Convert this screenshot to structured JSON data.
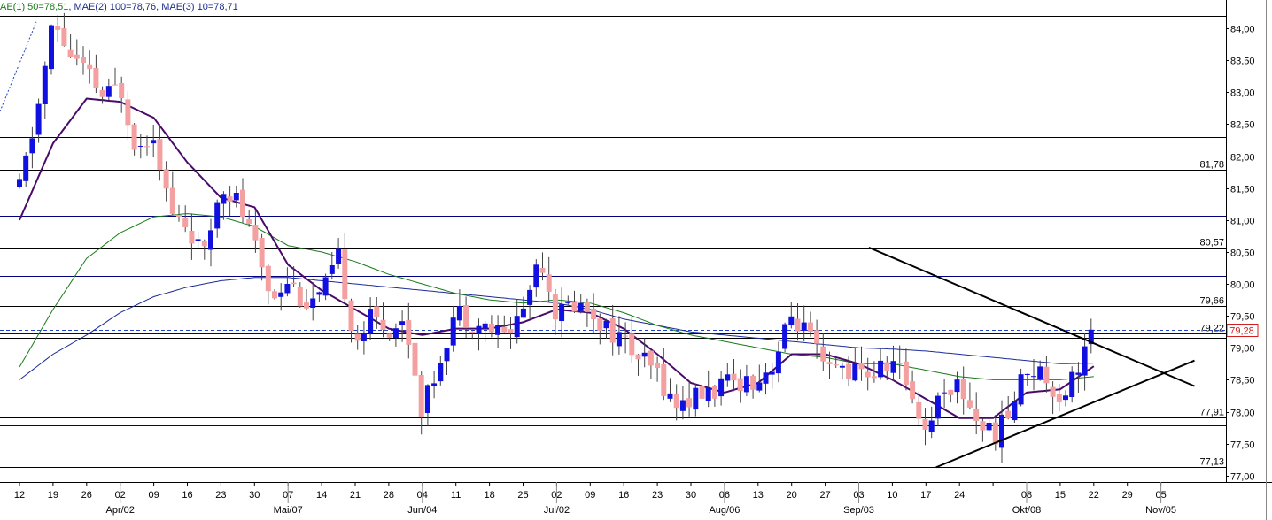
{
  "chart_data": {
    "type": "candlestick",
    "indicator_legend": [
      {
        "text": "AE(1) 50=78,51",
        "color": "#1a7a1a"
      },
      {
        "text": "MAE(2) 100=78,76",
        "color": "#1a2a8a"
      },
      {
        "text": "MAE(3) 10=78,71",
        "color": "#1a2a8a"
      }
    ],
    "y_axis": {
      "min": 76.9,
      "max": 84.25,
      "ticks": [
        "84,00",
        "83,50",
        "83,00",
        "82,50",
        "82,00",
        "81,50",
        "81,00",
        "80,50",
        "80,00",
        "79,50",
        "79,00",
        "78,50",
        "78,00",
        "77,50",
        "77,00"
      ],
      "tick_values": [
        84.0,
        83.5,
        83.0,
        82.5,
        82.0,
        81.5,
        81.0,
        80.5,
        80.0,
        79.5,
        79.0,
        78.5,
        78.0,
        77.5,
        77.0
      ]
    },
    "x_axis": {
      "day_labels": [
        "12",
        "19",
        "26",
        "02",
        "09",
        "16",
        "23",
        "30",
        "07",
        "14",
        "21",
        "28",
        "04",
        "11",
        "18",
        "25",
        "02",
        "09",
        "16",
        "23",
        "30",
        "06",
        "13",
        "20",
        "27",
        "03",
        "10",
        "17",
        "24",
        "",
        "08",
        "15",
        "22",
        "29",
        "05"
      ],
      "month_labels": [
        {
          "label": "Apr/02",
          "index": 3
        },
        {
          "label": "Mai/07",
          "index": 8
        },
        {
          "label": "Jun/04",
          "index": 12
        },
        {
          "label": "Jul/02",
          "index": 16
        },
        {
          "label": "Aug/06",
          "index": 21
        },
        {
          "label": "Sep/03",
          "index": 25
        },
        {
          "label": "Okt/08",
          "index": 30
        },
        {
          "label": "Nov/05",
          "index": 34
        }
      ]
    },
    "horizontal_levels": [
      {
        "value": 84.2,
        "label": "",
        "color": "#000000"
      },
      {
        "value": 82.3,
        "label": "",
        "color": "#000000"
      },
      {
        "value": 81.78,
        "label": "81,78",
        "color": "#000000"
      },
      {
        "value": 81.06,
        "label": "",
        "color": "#000080"
      },
      {
        "value": 80.57,
        "label": "80,57",
        "color": "#000000"
      },
      {
        "value": 80.12,
        "label": "",
        "color": "#000080"
      },
      {
        "value": 79.66,
        "label": "79,66",
        "color": "#000000"
      },
      {
        "value": 79.22,
        "label": "79,22",
        "color": "#000080"
      },
      {
        "value": 79.15,
        "label": "",
        "color": "#000000"
      },
      {
        "value": 77.91,
        "label": "77,91",
        "color": "#000000"
      },
      {
        "value": 77.78,
        "label": "",
        "color": "#000080"
      },
      {
        "value": 77.13,
        "label": "77,13",
        "color": "#000000"
      }
    ],
    "current_price": {
      "value": 79.28,
      "label": "79,28",
      "color": "#d02020"
    },
    "trendlines": [
      {
        "from": [
          25.3,
          80.57
        ],
        "to": [
          35.0,
          78.4
        ]
      },
      {
        "from": [
          27.3,
          77.13
        ],
        "to": [
          35.0,
          78.8
        ]
      }
    ],
    "ohlc_path": [
      [
        0,
        81.5
      ],
      [
        0.5,
        82.6
      ],
      [
        1,
        84.1
      ],
      [
        1.5,
        83.6
      ],
      [
        2,
        83.3
      ],
      [
        2.5,
        82.9
      ],
      [
        3,
        83.1
      ],
      [
        3.5,
        82.1
      ],
      [
        4,
        82.4
      ],
      [
        4.5,
        81.1
      ],
      [
        5,
        80.9
      ],
      [
        5.5,
        80.4
      ],
      [
        6,
        81.6
      ],
      [
        6.5,
        81.3
      ],
      [
        7,
        80.6
      ],
      [
        7.5,
        79.8
      ],
      [
        8,
        80.1
      ],
      [
        8.5,
        79.7
      ],
      [
        9,
        79.8
      ],
      [
        9.5,
        80.4
      ],
      [
        10,
        79.1
      ],
      [
        10.5,
        79.5
      ],
      [
        11,
        79.3
      ],
      [
        11.5,
        79.4
      ],
      [
        12,
        78.0
      ],
      [
        12.5,
        78.8
      ],
      [
        13,
        79.6
      ],
      [
        13.5,
        79.4
      ],
      [
        14,
        79.3
      ],
      [
        14.5,
        79.2
      ],
      [
        15,
        79.6
      ],
      [
        15.5,
        80.5
      ],
      [
        16,
        79.5
      ],
      [
        16.5,
        79.7
      ],
      [
        17,
        79.6
      ],
      [
        17.5,
        79.3
      ],
      [
        18,
        79.1
      ],
      [
        18.5,
        78.8
      ],
      [
        19,
        78.6
      ],
      [
        19.5,
        78.1
      ],
      [
        20,
        78.2
      ],
      [
        20.5,
        78.3
      ],
      [
        21,
        78.4
      ],
      [
        21.5,
        78.5
      ],
      [
        22,
        78.5
      ],
      [
        22.5,
        78.8
      ],
      [
        23,
        79.5
      ],
      [
        23.5,
        79.2
      ],
      [
        24,
        78.6
      ],
      [
        24.5,
        78.7
      ],
      [
        25,
        78.6
      ],
      [
        25.5,
        78.6
      ],
      [
        26,
        78.8
      ],
      [
        26.5,
        78.4
      ],
      [
        27,
        77.7
      ],
      [
        27.5,
        78.4
      ],
      [
        28,
        78.4
      ],
      [
        28.5,
        77.9
      ],
      [
        29,
        77.6
      ],
      [
        29.5,
        78.0
      ],
      [
        30,
        78.7
      ],
      [
        30.5,
        78.6
      ],
      [
        31,
        78.2
      ],
      [
        31.5,
        78.7
      ],
      [
        32,
        79.3
      ]
    ],
    "ma_green_path": [
      [
        0,
        78.7
      ],
      [
        1,
        79.6
      ],
      [
        2,
        80.4
      ],
      [
        3,
        80.8
      ],
      [
        4,
        81.05
      ],
      [
        5,
        81.1
      ],
      [
        6,
        81.05
      ],
      [
        7,
        80.9
      ],
      [
        8,
        80.6
      ],
      [
        9,
        80.5
      ],
      [
        10,
        80.35
      ],
      [
        11,
        80.15
      ],
      [
        12,
        80.0
      ],
      [
        13,
        79.85
      ],
      [
        14,
        79.75
      ],
      [
        15,
        79.7
      ],
      [
        16,
        79.75
      ],
      [
        17,
        79.7
      ],
      [
        18,
        79.55
      ],
      [
        19,
        79.35
      ],
      [
        20,
        79.2
      ],
      [
        21,
        79.1
      ],
      [
        22,
        79.0
      ],
      [
        23,
        78.9
      ],
      [
        24,
        78.85
      ],
      [
        25,
        78.75
      ],
      [
        26,
        78.75
      ],
      [
        27,
        78.65
      ],
      [
        28,
        78.55
      ],
      [
        29,
        78.5
      ],
      [
        30,
        78.5
      ],
      [
        31,
        78.5
      ],
      [
        32,
        78.55
      ]
    ],
    "ma_blue_path": [
      [
        0,
        78.5
      ],
      [
        1,
        78.9
      ],
      [
        2,
        79.2
      ],
      [
        3,
        79.55
      ],
      [
        4,
        79.8
      ],
      [
        5,
        79.95
      ],
      [
        6,
        80.05
      ],
      [
        7,
        80.1
      ],
      [
        8,
        80.1
      ],
      [
        9,
        80.05
      ],
      [
        10,
        80.0
      ],
      [
        11,
        79.95
      ],
      [
        12,
        79.9
      ],
      [
        13,
        79.85
      ],
      [
        14,
        79.8
      ],
      [
        15,
        79.75
      ],
      [
        16,
        79.7
      ],
      [
        17,
        79.6
      ],
      [
        18,
        79.45
      ],
      [
        19,
        79.35
      ],
      [
        20,
        79.25
      ],
      [
        21,
        79.2
      ],
      [
        22,
        79.15
      ],
      [
        23,
        79.1
      ],
      [
        24,
        79.05
      ],
      [
        25,
        79.0
      ],
      [
        26,
        78.98
      ],
      [
        27,
        78.95
      ],
      [
        28,
        78.9
      ],
      [
        29,
        78.85
      ],
      [
        30,
        78.8
      ],
      [
        31,
        78.75
      ],
      [
        32,
        78.76
      ]
    ],
    "ma_purple_path": [
      [
        0,
        81.0
      ],
      [
        1,
        82.2
      ],
      [
        2,
        82.9
      ],
      [
        3,
        82.85
      ],
      [
        4,
        82.6
      ],
      [
        5,
        81.9
      ],
      [
        6,
        81.35
      ],
      [
        7,
        81.2
      ],
      [
        8,
        80.3
      ],
      [
        9,
        79.9
      ],
      [
        10,
        79.6
      ],
      [
        11,
        79.3
      ],
      [
        12,
        79.2
      ],
      [
        13,
        79.3
      ],
      [
        14,
        79.3
      ],
      [
        15,
        79.4
      ],
      [
        16,
        79.6
      ],
      [
        17,
        79.55
      ],
      [
        18,
        79.3
      ],
      [
        19,
        78.9
      ],
      [
        20,
        78.45
      ],
      [
        21,
        78.3
      ],
      [
        22,
        78.45
      ],
      [
        23,
        78.9
      ],
      [
        24,
        78.9
      ],
      [
        25,
        78.75
      ],
      [
        26,
        78.5
      ],
      [
        27,
        78.2
      ],
      [
        28,
        77.9
      ],
      [
        29,
        77.9
      ],
      [
        30,
        78.3
      ],
      [
        31,
        78.35
      ],
      [
        32,
        78.71
      ]
    ]
  }
}
